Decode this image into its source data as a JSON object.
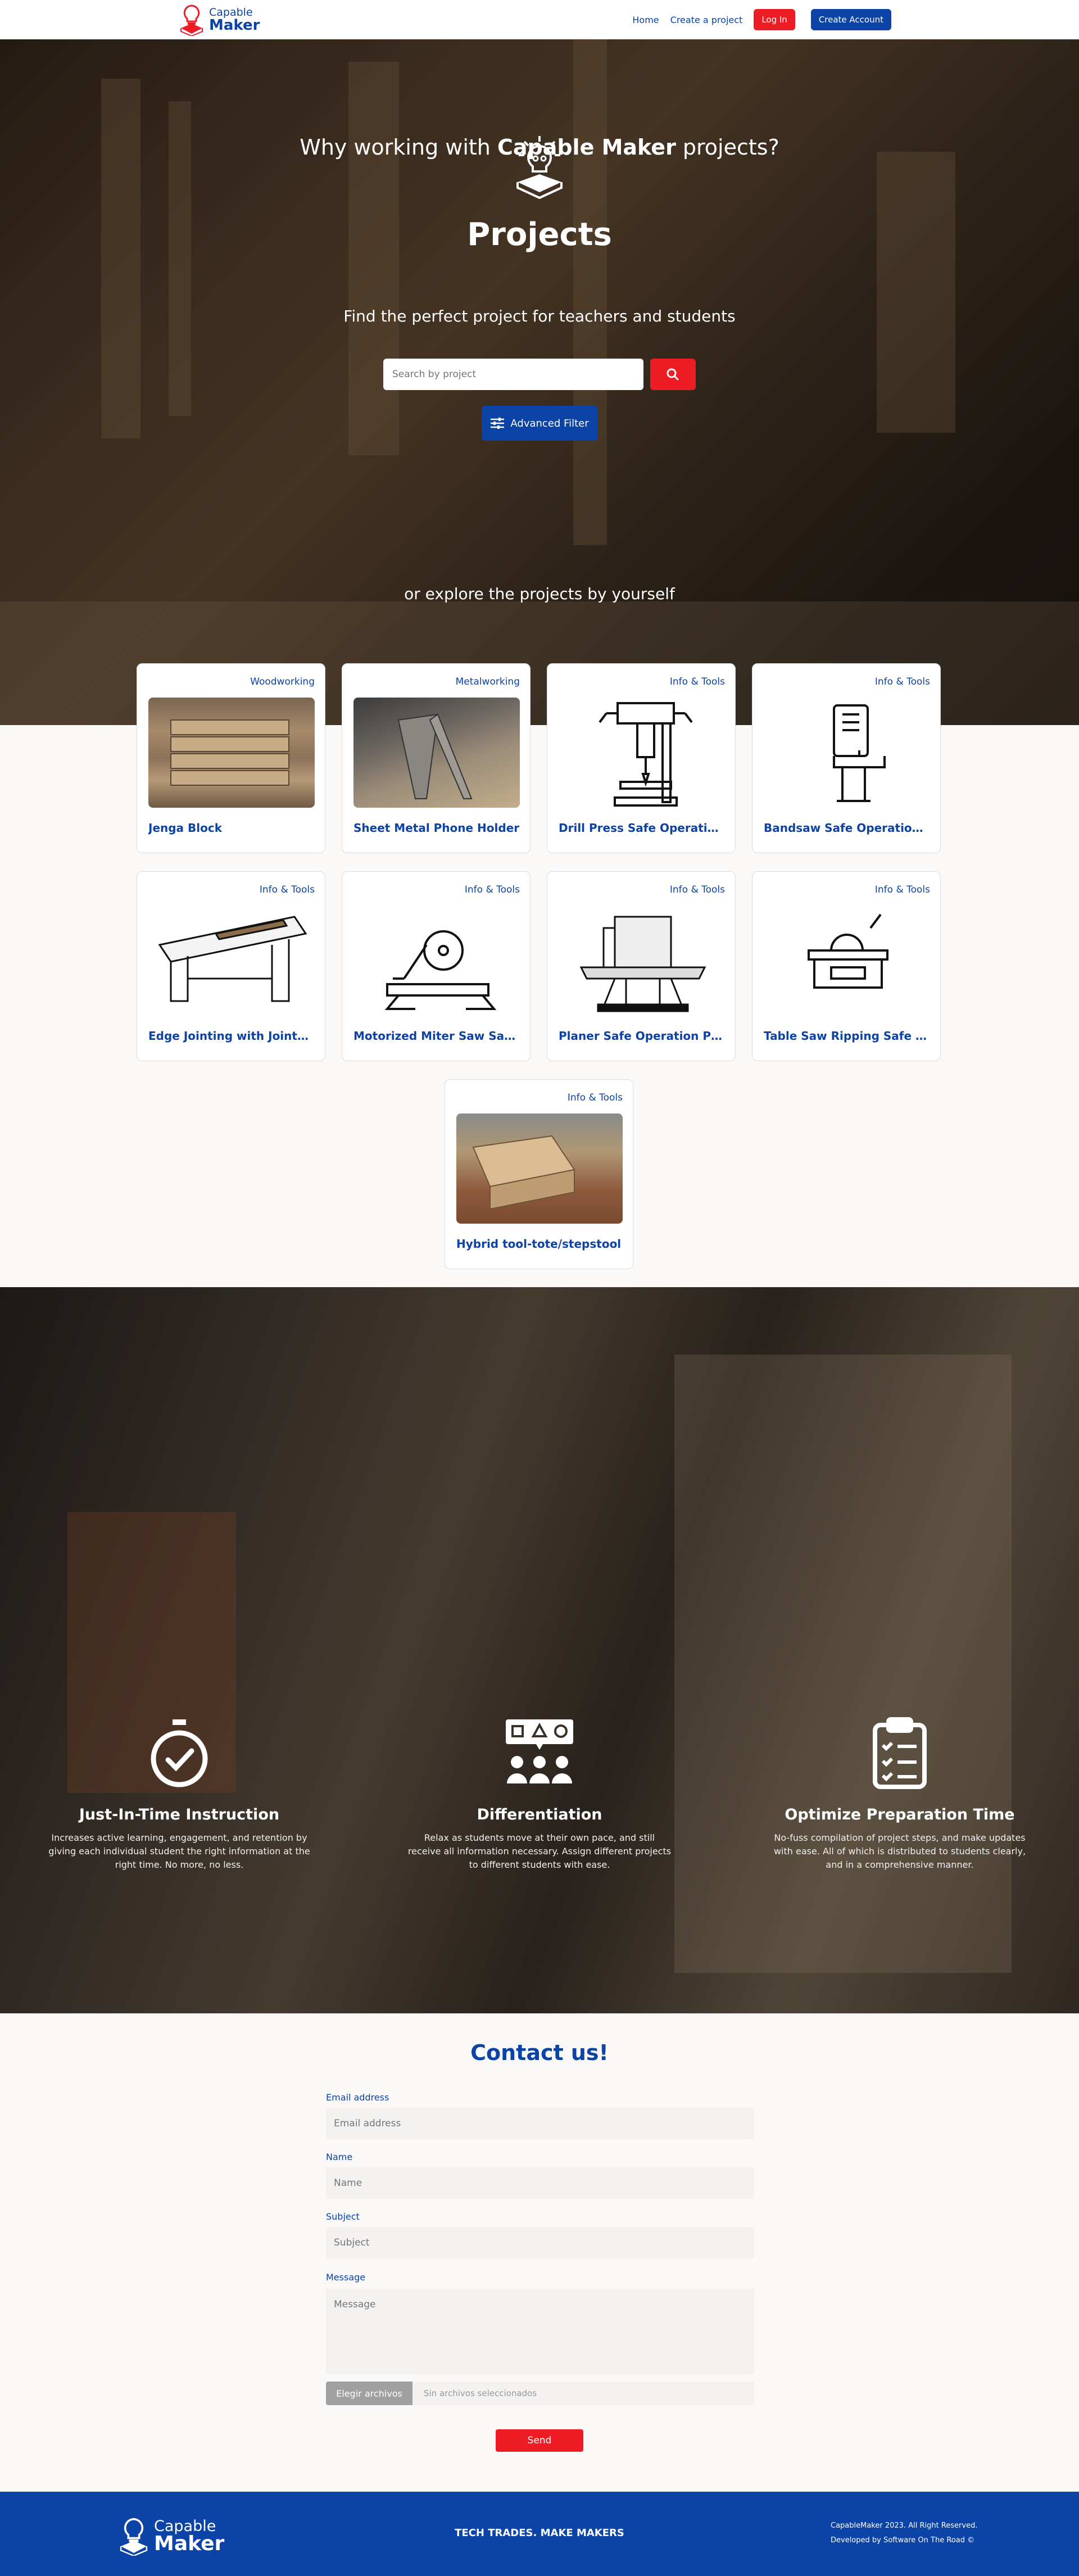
{
  "brand": {
    "line1": "Capable",
    "line2": "Maker"
  },
  "nav": {
    "home": "Home",
    "create_project": "Create a project",
    "login": "Log In",
    "create_account": "Create Account"
  },
  "hero": {
    "title": "Projects",
    "subtitle": "Find the perfect project for teachers and students",
    "search_placeholder": "Search by project",
    "search_icon": "search-icon",
    "advanced_filter": "Advanced Filter",
    "explore": "or explore the projects by yourself"
  },
  "projects": [
    {
      "category": "Woodworking",
      "title": "Jenga Block",
      "image": "wood-blocks-photo"
    },
    {
      "category": "Metalworking",
      "title": "Sheet Metal Phone Holder",
      "image": "metal-phone-holder-photo"
    },
    {
      "category": "Info & Tools",
      "title": "Drill Press Safe Operation ...",
      "image": "drill-press-icon"
    },
    {
      "category": "Info & Tools",
      "title": "Bandsaw Safe Operation ...",
      "image": "bandsaw-icon"
    },
    {
      "category": "Info & Tools",
      "title": "Edge Jointing with Jointer...",
      "image": "jointer-icon"
    },
    {
      "category": "Info & Tools",
      "title": "Motorized Miter Saw Safe ...",
      "image": "miter-saw-icon"
    },
    {
      "category": "Info & Tools",
      "title": "Planer Safe Operation Pro...",
      "image": "planer-icon"
    },
    {
      "category": "Info & Tools",
      "title": "Table Saw Ripping Safe O...",
      "image": "table-saw-icon"
    },
    {
      "category": "Info & Tools",
      "title": "Hybrid tool-tote/stepstool",
      "image": "tool-tote-photo"
    }
  ],
  "why": {
    "title_prefix": "Why working with ",
    "title_brand": "Capable Maker",
    "title_suffix": " projects?",
    "features": [
      {
        "icon": "stopwatch-icon",
        "title": "Just-In-Time Instruction",
        "text": "Increases active learning, engagement, and retention by giving each individual student the right information at the right time. No more, no less."
      },
      {
        "icon": "group-shapes-icon",
        "title": "Differentiation",
        "text": "Relax as students move at their own pace, and still receive all information necessary. Assign different projects to different students with ease."
      },
      {
        "icon": "clipboard-checklist-icon",
        "title": "Optimize Preparation Time",
        "text": "No-fuss compilation of project steps, and make updates with ease. All of which is distributed to students clearly, and in a comprehensive manner."
      }
    ]
  },
  "contact": {
    "title": "Contact us!",
    "email_label": "Email address",
    "email_placeholder": "Email address",
    "name_label": "Name",
    "name_placeholder": "Name",
    "subject_label": "Subject",
    "subject_placeholder": "Subject",
    "message_label": "Message",
    "message_placeholder": "Message",
    "file_button": "Elegir archivos",
    "file_status": "Sin archivos seleccionados",
    "send": "Send"
  },
  "footer": {
    "tagline": "TECH TRADES. MAKE MAKERS",
    "copyright": "CapableMaker 2023. All Right Reserved.",
    "developed": "Developed by Software On The Road ©"
  },
  "colors": {
    "primary": "#0b43a6",
    "accent": "#ee1c25",
    "background": "#faf9f8"
  }
}
